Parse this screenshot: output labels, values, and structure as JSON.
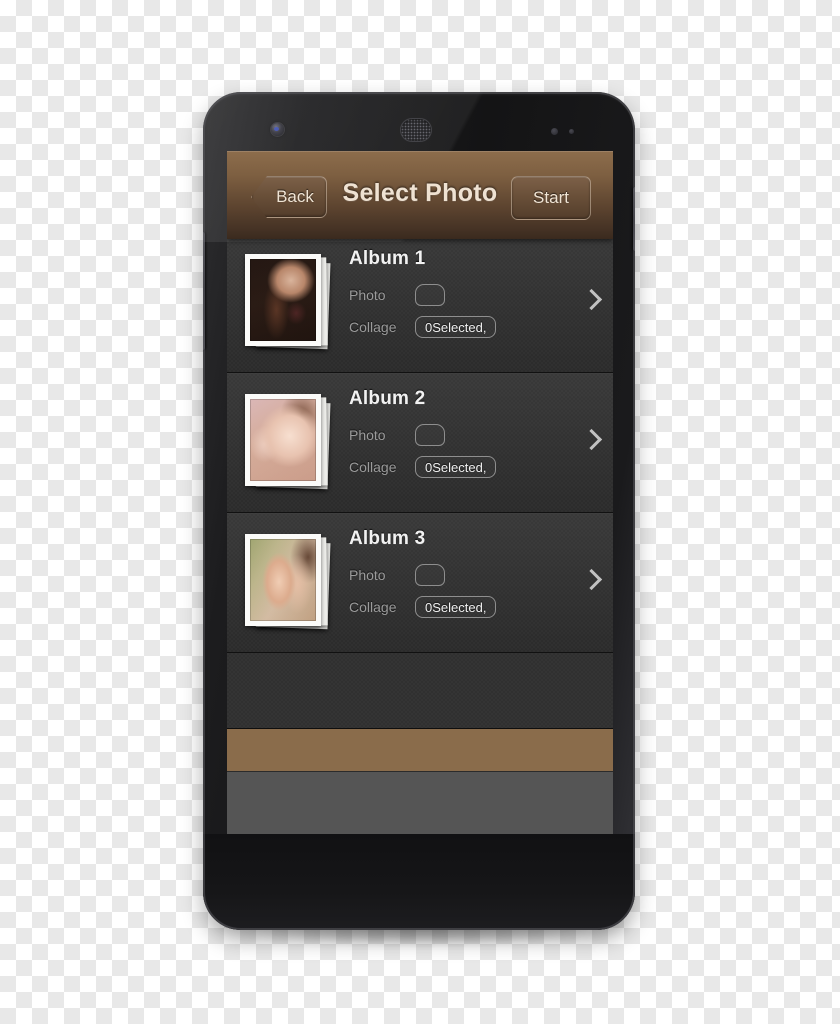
{
  "device": {
    "name": "smartphone-mockup",
    "hardware": {
      "front_camera": "camera-icon",
      "earpiece": "speaker-grille-icon",
      "sensor_1": "proximity-sensor-icon",
      "sensor_2": "light-sensor-icon",
      "power_button": "power-button",
      "volume_button": "volume-rocker"
    }
  },
  "header": {
    "title": "Select Photo",
    "back_label": "Back",
    "start_label": "Start",
    "background_color": "#7d5f41",
    "text_color": "#efe2d2"
  },
  "list": {
    "clipped_top_row": {
      "collage_label": "Collage",
      "collage_value": "0Selected,"
    },
    "rows": [
      {
        "title": "Album 1",
        "photo_label": "Photo",
        "photo_value": "",
        "collage_label": "Collage",
        "collage_value": "0Selected,",
        "thumbnail": "portrait-woman-tattoo-photo",
        "chevron": "chevron-right-icon"
      },
      {
        "title": "Album 2",
        "photo_label": "Photo",
        "photo_value": "",
        "collage_label": "Collage",
        "collage_value": "0Selected,",
        "thumbnail": "portrait-woman-closeup-photo",
        "chevron": "chevron-right-icon"
      },
      {
        "title": "Album 3",
        "photo_label": "Photo",
        "photo_value": "",
        "collage_label": "Collage",
        "collage_value": "0Selected,",
        "thumbnail": "two-women-outdoor-photo",
        "chevron": "chevron-right-icon"
      }
    ]
  },
  "footer": {
    "banner_color": "#8a6c4b",
    "panel_color": "#555555"
  }
}
